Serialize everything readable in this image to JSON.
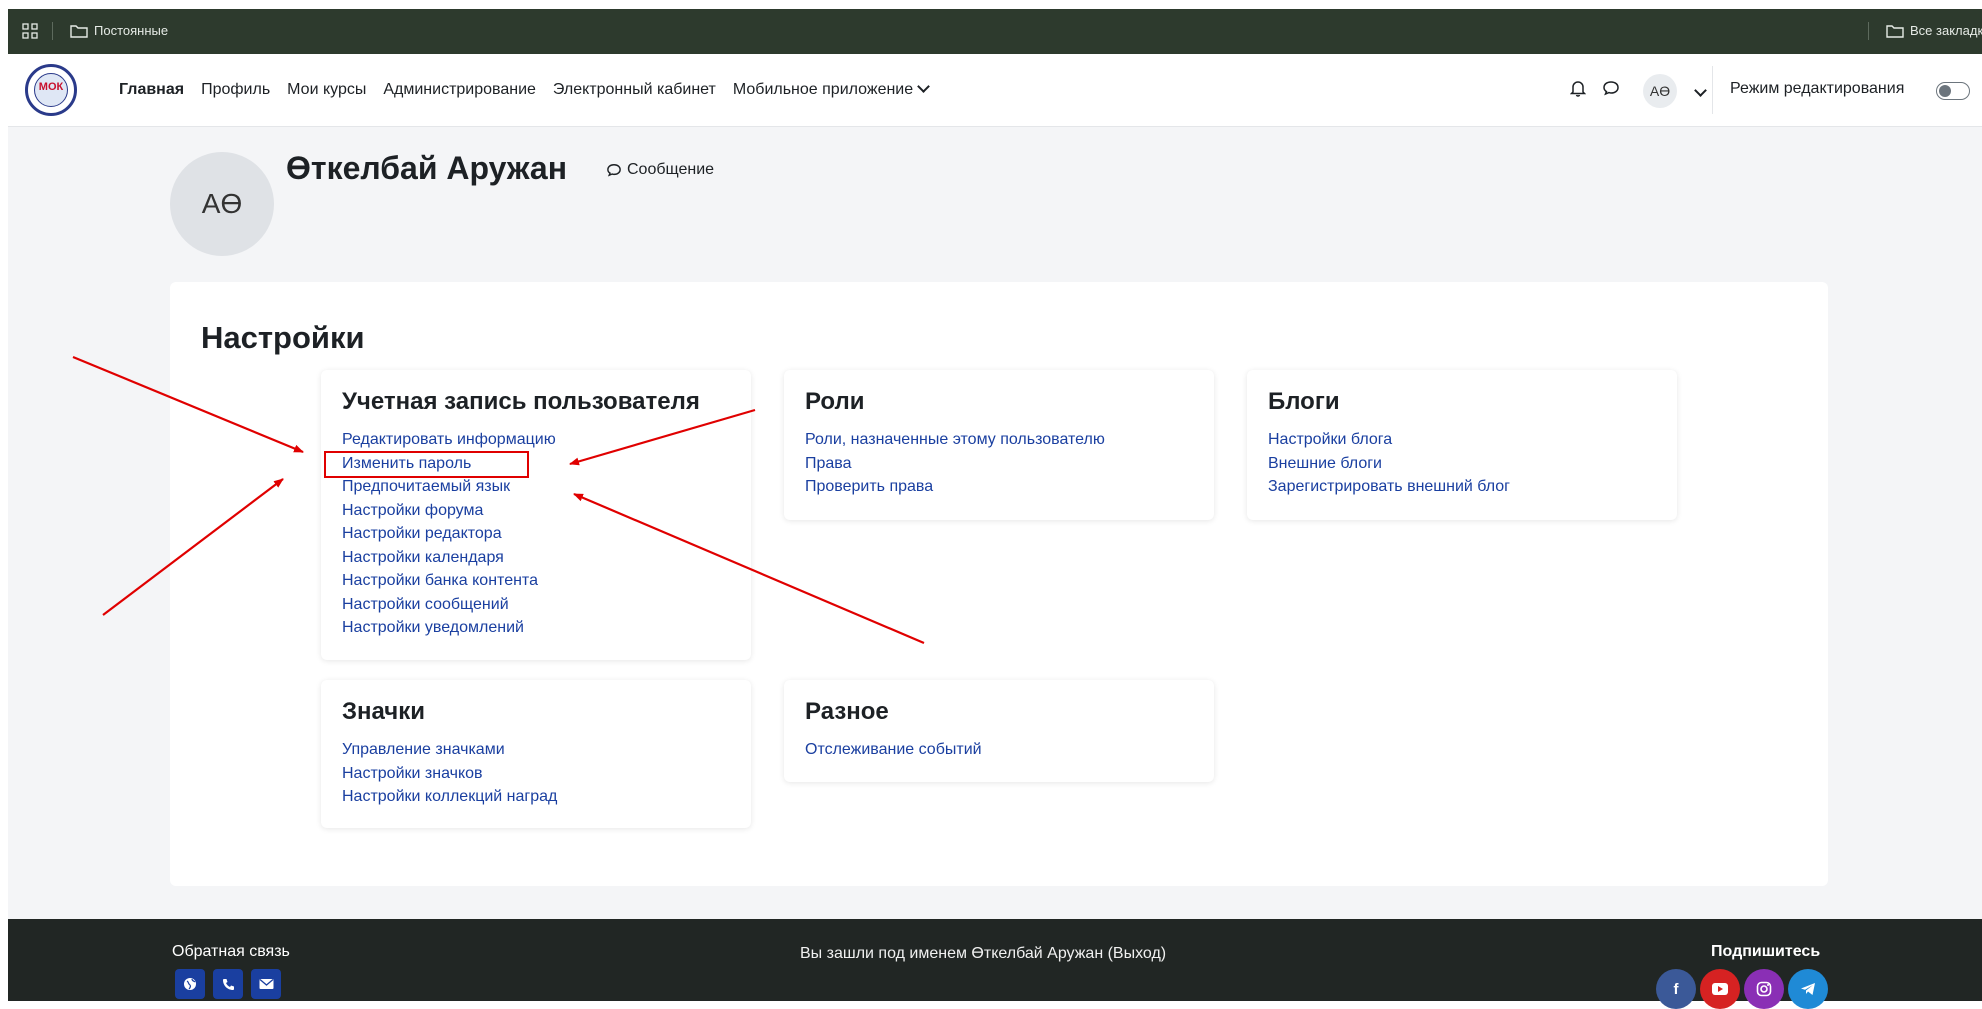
{
  "bookmarks": {
    "left_folder": "Постоянные",
    "right_folder": "Все закладки"
  },
  "navbar": {
    "logo_text": "МОК",
    "links": [
      "Главная",
      "Профиль",
      "Мои курсы",
      "Администрирование",
      "Электронный кабинет",
      "Мобильное приложение"
    ],
    "user_initials": "АӨ",
    "edit_mode_label": "Режим редактирования"
  },
  "profile": {
    "initials": "АӨ",
    "name": "Өткелбай Аружан",
    "message_label": "Сообщение"
  },
  "settings": {
    "title": "Настройки",
    "account": {
      "title": "Учетная запись пользователя",
      "links": [
        "Редактировать информацию",
        "Изменить пароль",
        "Предпочитаемый язык",
        "Настройки форума",
        "Настройки редактора",
        "Настройки календаря",
        "Настройки банка контента",
        "Настройки сообщений",
        "Настройки уведомлений"
      ]
    },
    "roles": {
      "title": "Роли",
      "links": [
        "Роли, назначенные этому пользователю",
        "Права",
        "Проверить права"
      ]
    },
    "blogs": {
      "title": "Блоги",
      "links": [
        "Настройки блога",
        "Внешние блоги",
        "Зарегистрировать внешний блог"
      ]
    },
    "badges": {
      "title": "Значки",
      "links": [
        "Управление значками",
        "Настройки значков",
        "Настройки коллекций наград"
      ]
    },
    "misc": {
      "title": "Разное",
      "links": [
        "Отслеживание событий"
      ]
    }
  },
  "footer": {
    "feedback_title": "Обратная связь",
    "logged_in_text": "Вы зашли под именем Өткелбай Аружан (Выход)",
    "subscribe_title": "Подпишитесь"
  },
  "colors": {
    "bookmark_bar": "#2d3a2d",
    "link": "#1a3fa0",
    "annotation": "#e00000",
    "footer": "#212624",
    "facebook": "#3b5998",
    "youtube": "#d62222",
    "instagram": "#8a2fb5",
    "telegram": "#1f8ad6"
  }
}
